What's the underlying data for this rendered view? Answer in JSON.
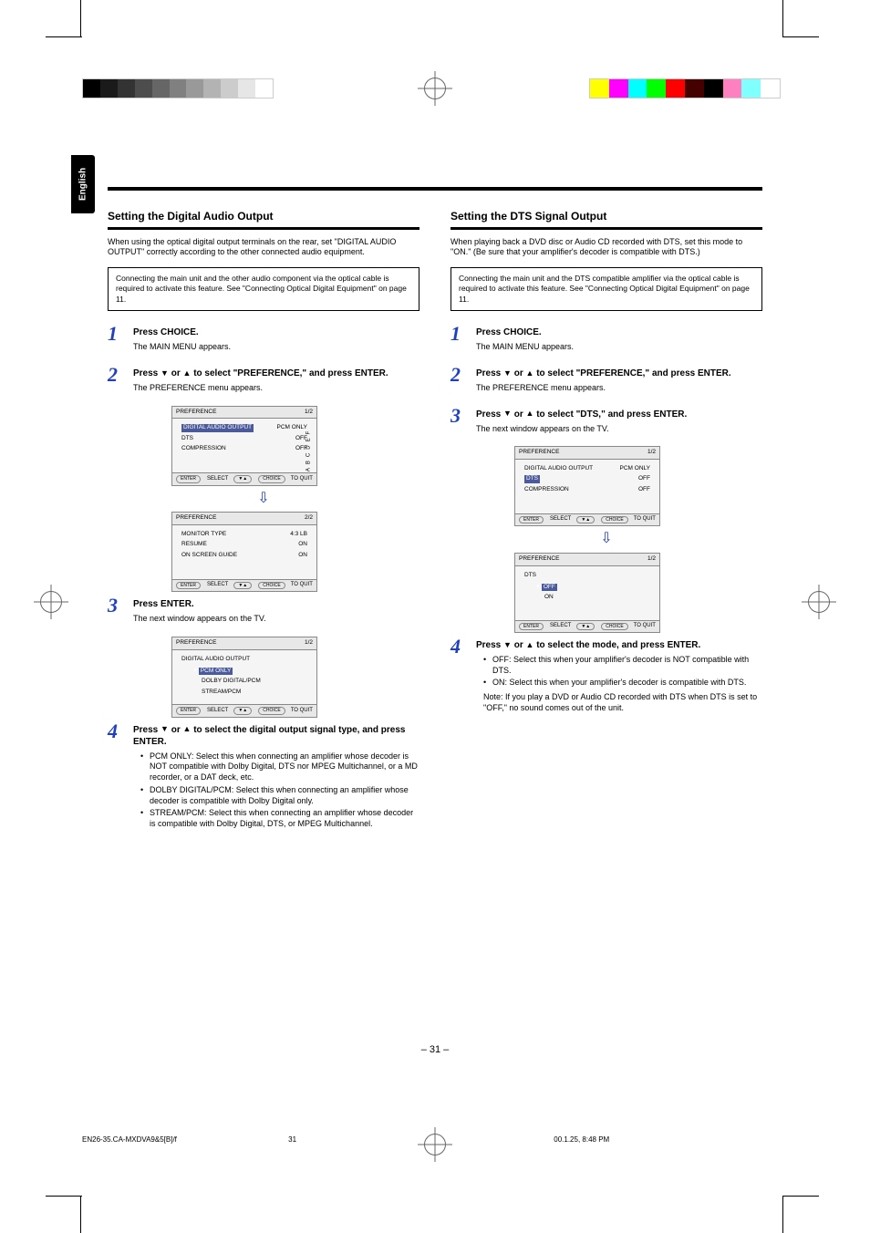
{
  "language_tab": "English",
  "left": {
    "title": "Setting the Digital Audio Output",
    "intro": "When using the optical digital output terminals on the rear, set \"DIGITAL AUDIO OUTPUT\" correctly according to the other connected audio equipment.",
    "panel": "Connecting the main unit and the other audio component via the optical cable is required to activate this feature. See \"Connecting Optical Digital Equipment\" on page 11.",
    "step1": {
      "title": "Press CHOICE.",
      "p": "The MAIN MENU appears."
    },
    "step2": {
      "title_pre": "Press ",
      "title_mid": " or ",
      "title_post": " to select \"PREFERENCE,\" and press ENTER.",
      "p": "The PREFERENCE menu appears."
    },
    "tv1": {
      "title": "PREFERENCE",
      "page": "1/2",
      "row1_label": "DIGITAL AUDIO OUTPUT",
      "row1_value": "PCM ONLY",
      "row2_label": "DTS",
      "row2_value": "OFF",
      "row3_label": "COMPRESSION",
      "row3_value": "OFF",
      "rotated": "ABCDEF",
      "enter": "ENTER",
      "select": "SELECT",
      "choice": "CHOICE",
      "to_quit": "TO QUIT"
    },
    "tv2": {
      "title": "PREFERENCE",
      "page": "2/2",
      "row1_label": "MONITOR TYPE",
      "row1_value": "4:3 LB",
      "row2_label": "RESUME",
      "row2_value": "ON",
      "row3_label": "ON SCREEN GUIDE",
      "row3_value": "ON"
    },
    "step3": {
      "title": "Press ENTER.",
      "p": "The next window appears on the TV."
    },
    "tv3": {
      "title": "PREFERENCE",
      "page": "1/2",
      "header": "DIGITAL AUDIO OUTPUT",
      "opt1": "PCM ONLY",
      "opt2": "DOLBY DIGITAL/PCM",
      "opt3": "STREAM/PCM"
    },
    "step4": {
      "title_post": " to select the digital output signal type, and press ENTER.",
      "opts": [
        "PCM ONLY: Select this when connecting an amplifier whose decoder is NOT compatible with Dolby Digital, DTS nor MPEG Multichannel, or a MD recorder, or a DAT deck, etc.",
        "DOLBY DIGITAL/PCM: Select this when connecting an amplifier whose decoder is compatible with Dolby Digital only.",
        "STREAM/PCM: Select this when connecting an amplifier whose decoder is compatible with Dolby Digital, DTS, or MPEG Multichannel."
      ]
    }
  },
  "right": {
    "title": "Setting the DTS Signal Output",
    "intro": "When playing back a DVD disc or Audio CD recorded with DTS, set this mode to \"ON.\" (Be sure that your amplifier's decoder is compatible with DTS.)",
    "panel": "Connecting the main unit and the DTS compatible amplifier via the optical cable is required to activate this feature. See \"Connecting Optical Digital Equipment\" on page 11.",
    "step1": {
      "title": "Press CHOICE.",
      "p": "The MAIN MENU appears."
    },
    "step2": {
      "title_post": " to select \"PREFERENCE,\" and press ENTER.",
      "p": "The PREFERENCE menu appears."
    },
    "step3": {
      "title_post": " to select \"DTS,\" and press ENTER.",
      "p": "The next window appears on the TV."
    },
    "tv1": {
      "title": "PREFERENCE",
      "page": "1/2",
      "row1_label": "DIGITAL AUDIO OUTPUT",
      "row1_value": "PCM ONLY",
      "row2_label": "DTS",
      "row2_value": "OFF",
      "row3_label": "COMPRESSION",
      "row3_value": "OFF"
    },
    "tv2": {
      "title": "PREFERENCE",
      "page": "1/2",
      "header": "DTS",
      "opt1": "OFF",
      "opt2": "ON"
    },
    "step4": {
      "title_post": " to select the mode, and press ENTER.",
      "opts": [
        "OFF: Select this when your amplifier's decoder is NOT compatible with DTS.",
        "ON: Select this when your amplifier's decoder is compatible with DTS."
      ],
      "note": "Note: If you play a DVD or Audio CD recorded with DTS when DTS is set to \"OFF,\" no sound comes out of the unit."
    }
  },
  "page_number": "– 31 –",
  "filename": "EN26-35.CA-MXDVA9&5[B]/f",
  "file_page": "31",
  "file_time": "00.1.25, 8:48 PM"
}
